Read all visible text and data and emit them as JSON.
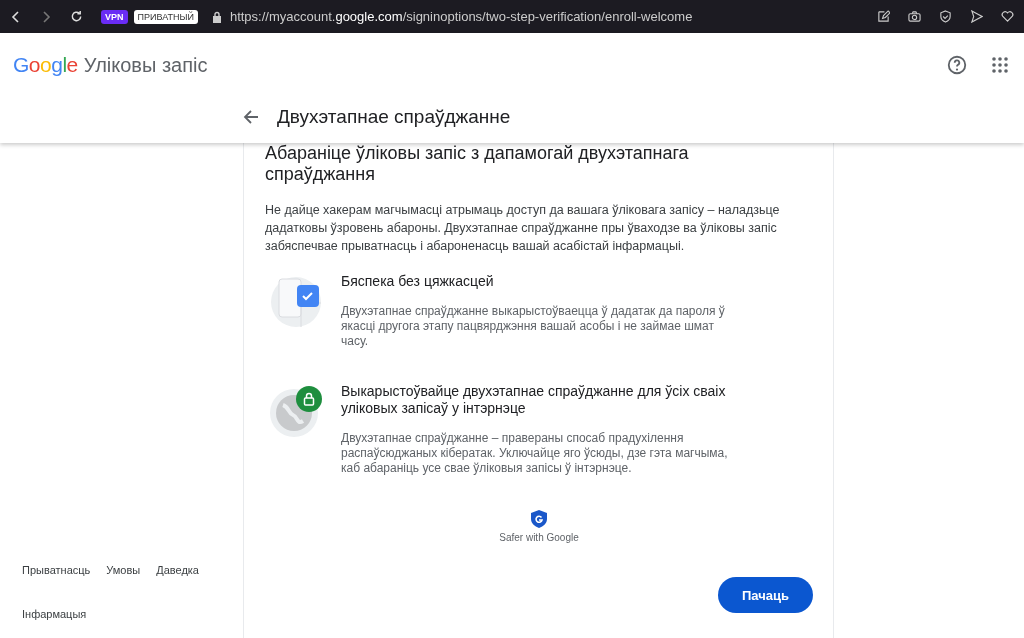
{
  "browser": {
    "vpn_badge": "VPN",
    "private_badge": "ПРИВАТНЫЙ",
    "url_prefix": "https://myaccount.",
    "url_domain": "google.com",
    "url_path": "/signinoptions/two-step-verification/enroll-welcome"
  },
  "header": {
    "logo": "Google",
    "product": "Уліковы запіс"
  },
  "page_title": "Двухэтапнае спраўджанне",
  "card": {
    "heading": "Абараніце ўліковы запіс з дапамогай двухэтапнага спраўджання",
    "intro": "Не дайце хакерам магчымасці атрымаць доступ да вашага ўліковага запісу – наладзьце дадатковы ўзровень абароны. Двухэтапнае спраўджанне пры ўваходзе ва ўліковы запіс забяспечвае прыватнасць і абароненасць вашай асабістай інфармацыі.",
    "features": [
      {
        "kind": "check",
        "title": "Бяспека без цяжкасцей",
        "text": "Двухэтапнае спраўджанне выкарыстоўваецца ў дадатак да пароля ў якасці другога этапу пацвярджэння вашай асобы і не займае шмат часу."
      },
      {
        "kind": "lock",
        "title": "Выкарыстоўвайце двухэтапнае спраўджанне для ўсіх сваіх уліковых запісаў у інтэрнэце",
        "text": "Двухэтапнае спраўджанне – правераны спосаб прадухілення распаўсюджаных кібератак. Уключайце яго ўсюды, дзе гэта магчыма, каб абараніць усе свае ўліковыя запісы ў інтэрнэце."
      }
    ],
    "badge": "Safer with Google",
    "button": "Пачаць"
  },
  "footer_links": [
    "Прыватнасць",
    "Умовы",
    "Даведка",
    "Інфармацыя"
  ]
}
